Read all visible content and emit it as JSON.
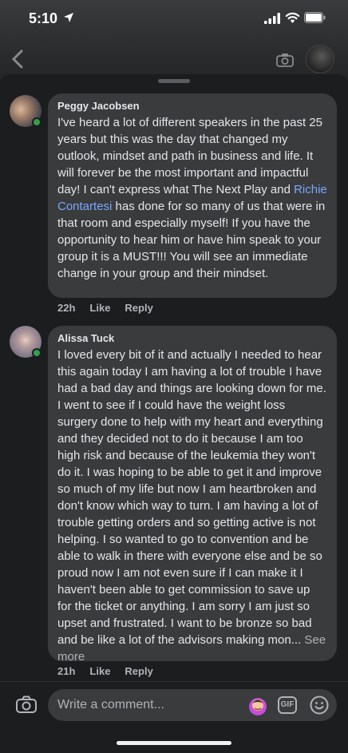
{
  "status_bar": {
    "time": "5:10"
  },
  "comments": [
    {
      "author": "Peggy Jacobsen",
      "text_before": "I've heard a lot of different speakers in the past 25 years but this was the day that changed my outlook, mindset and path in business and life. It will forever be the most important and impactful day! I can't express what The Next Play and ",
      "mention": "Richie Contartesi",
      "text_after": " has done for so many of us that were in that room and especially myself! If you have the opportunity to hear him or have him speak to your group it is a MUST!!! You will see an immediate change in your group and their mindset.",
      "time": "22h",
      "like_label": "Like",
      "reply_label": "Reply"
    },
    {
      "author": "Alissa Tuck",
      "text": "I loved every bit of it and actually I needed to hear this again today I am having a lot of trouble I have had a bad day and things are looking down for me. I went to see if I could have the weight loss surgery done to help with my heart and everything and they decided not to do it because I am too high risk and because of the leukemia they won't do it. I was hoping to be able to get it and improve so much of my life but now I am heartbroken and don't know which way to turn. I am having a lot of trouble getting orders and so getting active is not helping. I so wanted to go to convention and be able to walk in there with everyone else and be so proud now I am not even sure if I can make it I haven't been able to get commission to save up for the ticket or anything. I am sorry I am just so upset and frustrated. I want to be bronze so bad and be like a lot of the advisors making mon...",
      "see_more": "See more",
      "time": "21h",
      "like_label": "Like",
      "reply_label": "Reply"
    }
  ],
  "composer": {
    "placeholder": "Write a comment...",
    "gif_label": "GIF"
  },
  "colors": {
    "bubble": "#3a3b3c",
    "mention": "#7aa7ff",
    "online": "#31a24c"
  }
}
